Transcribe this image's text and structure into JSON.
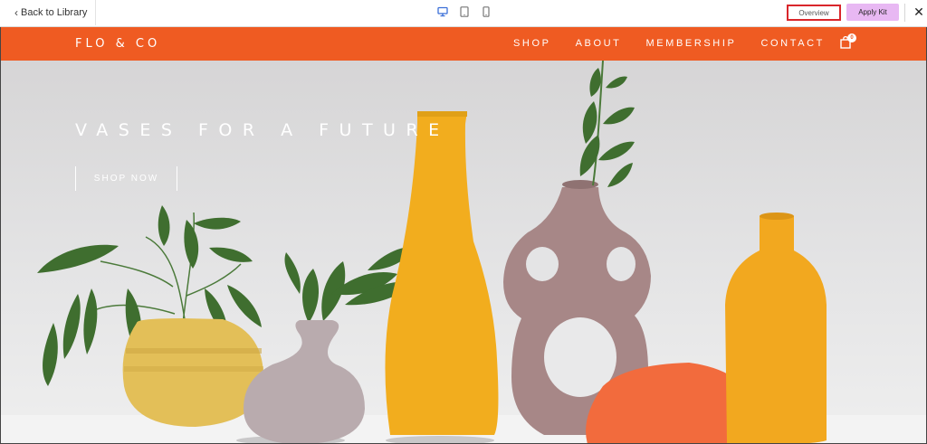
{
  "editor": {
    "back_label": "Back to Library",
    "devices": [
      {
        "name": "desktop-icon",
        "active": true
      },
      {
        "name": "tablet-icon",
        "active": false
      },
      {
        "name": "mobile-icon",
        "active": false
      }
    ],
    "overview_label": "Overview",
    "apply_label": "Apply Kit",
    "close_glyph": "✕",
    "colors": {
      "active_device": "#3b6fd8",
      "inactive_device": "#777777",
      "apply_bg": "#e8b8f3",
      "highlight_border": "#d9262b"
    }
  },
  "site": {
    "brand": "FLO & CO",
    "nav": [
      "SHOP",
      "ABOUT",
      "MEMBERSHIP",
      "CONTACT"
    ],
    "cart_count": "0",
    "colors": {
      "accent": "#ef5b22",
      "text": "#ffffff"
    },
    "hero": {
      "title": "VASES FOR A FUTURE",
      "cta": "SHOP NOW"
    }
  }
}
